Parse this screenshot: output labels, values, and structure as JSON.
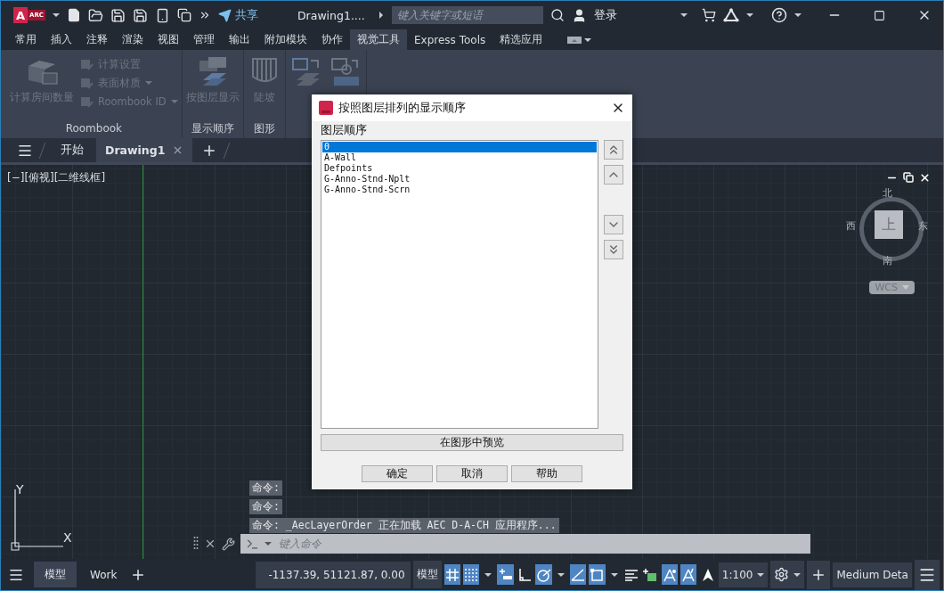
{
  "title_bar": {
    "app_logo": "A",
    "app_badge": "ARC",
    "share": "共享",
    "document": "Drawing1....",
    "search": {
      "placeholder": "键入关键字或短语"
    },
    "login": "登录"
  },
  "ribbon_tabs": [
    {
      "label": "常用",
      "selected": false
    },
    {
      "label": "插入",
      "selected": false
    },
    {
      "label": "注释",
      "selected": false
    },
    {
      "label": "渲染",
      "selected": false
    },
    {
      "label": "视图",
      "selected": false
    },
    {
      "label": "管理",
      "selected": false
    },
    {
      "label": "输出",
      "selected": false
    },
    {
      "label": "附加模块",
      "selected": false
    },
    {
      "label": "协作",
      "selected": false
    },
    {
      "label": "视觉工具",
      "selected": true
    },
    {
      "label": "Express Tools",
      "selected": false
    },
    {
      "label": "精选应用",
      "selected": false
    }
  ],
  "ribbon_panels": [
    {
      "title": "Roombook",
      "large": [
        {
          "label": "计算房间数量"
        }
      ],
      "small": [
        {
          "label": "计算设置",
          "menu": false
        },
        {
          "label": "表面材质",
          "menu": true
        },
        {
          "label": "Roombook ID",
          "menu": true
        }
      ]
    },
    {
      "title": "显示顺序",
      "large": [
        {
          "label": "按图层显示"
        }
      ]
    },
    {
      "title": "图形",
      "large": [
        {
          "label": "陡坡"
        }
      ]
    }
  ],
  "doc_tabs": [
    {
      "label": "开始",
      "selected": false
    },
    {
      "label": "Drawing1",
      "selected": true
    }
  ],
  "viewport_label": "[−][俯视][二维线框]",
  "viewcube": {
    "north": "北",
    "south": "南",
    "east": "东",
    "west": "西",
    "face": "上",
    "ucs": "WCS"
  },
  "ucs_icon": {
    "x": "X",
    "y": "Y"
  },
  "command_history": [
    "命令:",
    "命令:",
    "命令: _AecLayerOrder 正在加载 AEC D-A-CH 应用程序..."
  ],
  "command_line": {
    "placeholder": "键入命令"
  },
  "status_bar": {
    "layout_tabs": [
      {
        "label": "模型",
        "selected": true
      },
      {
        "label": "Work",
        "selected": false
      }
    ],
    "coordinates": "-1137.39, 51121.87, 0.00",
    "space": "模型",
    "toggles": [
      {
        "kind": "grid",
        "on": true,
        "menu": false
      },
      {
        "kind": "snap",
        "on": true,
        "menu": true
      },
      {
        "kind": "infer",
        "on": true,
        "menu": false
      },
      {
        "kind": "ortho",
        "on": false,
        "menu": false
      },
      {
        "kind": "polar",
        "on": true,
        "menu": true
      },
      {
        "kind": "iso",
        "on": true,
        "menu": false
      },
      {
        "kind": "osnap",
        "on": true,
        "menu": true
      },
      {
        "kind": "lineweight",
        "on": false,
        "menu": false
      },
      {
        "kind": "transparency",
        "on": false,
        "menu": false
      },
      {
        "kind": "annoauto",
        "on": true,
        "menu": false
      },
      {
        "kind": "annoadd",
        "on": true,
        "menu": false
      },
      {
        "kind": "annovis",
        "on": false,
        "menu": false
      }
    ],
    "scale": "1:100",
    "detail": "Medium Deta"
  },
  "dialog": {
    "title": "按照图层排列的显示顺序",
    "group": "图层顺序",
    "layers": [
      {
        "name": "0",
        "selected": true
      },
      {
        "name": "A-Wall",
        "selected": false
      },
      {
        "name": "Defpoints",
        "selected": false
      },
      {
        "name": "G-Anno-Stnd-Nplt",
        "selected": false
      },
      {
        "name": "G-Anno-Stnd-Scrn",
        "selected": false
      }
    ],
    "preview_button": "在图形中预览",
    "buttons": [
      "确定",
      "取消",
      "帮助"
    ]
  }
}
